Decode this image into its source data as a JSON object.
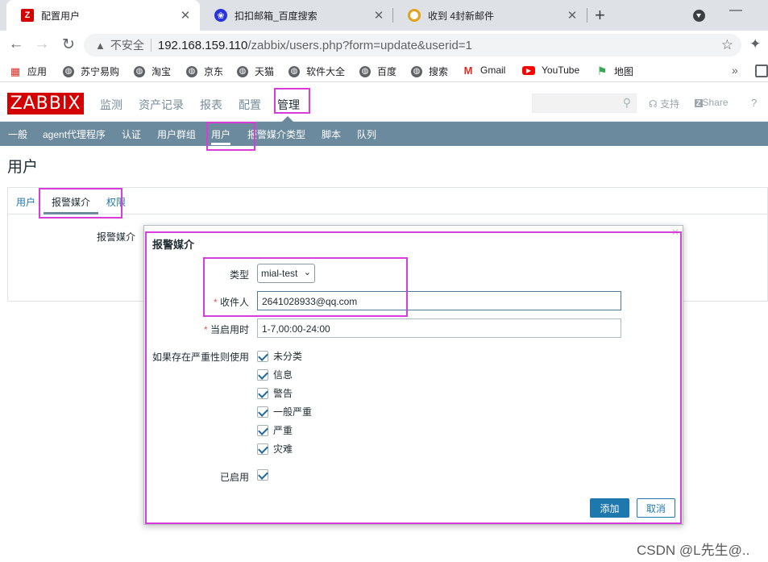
{
  "browser": {
    "tabs": [
      {
        "title": "配置用户",
        "favicon": "zabbix-z"
      },
      {
        "title": "扣扣邮箱_百度搜索",
        "favicon": "baidu-paw"
      },
      {
        "title": "收到 4封新邮件",
        "favicon": "mail-ring"
      }
    ],
    "omnibox": {
      "security_label": "不安全",
      "host": "192.168.159.110",
      "path": "/zabbix/users.php?form=update&userid=1"
    },
    "bookmarks": [
      "应用",
      "苏宁易购",
      "淘宝",
      "京东",
      "天猫",
      "软件大全",
      "百度",
      "搜索",
      "Gmail",
      "YouTube",
      "地图"
    ]
  },
  "zabbix": {
    "logo": "ZABBIX",
    "menu": [
      "监测",
      "资产记录",
      "报表",
      "配置",
      "管理"
    ],
    "support": "支持",
    "share": "Share",
    "help": "?",
    "submenu": [
      "一般",
      "agent代理程序",
      "认证",
      "用户群组",
      "用户",
      "报警媒介类型",
      "脚本",
      "队列"
    ],
    "page_title": "用户",
    "form_tabs": [
      "用户",
      "报警媒介",
      "权限"
    ],
    "media_label": "报警媒介"
  },
  "dialog": {
    "title": "报警媒介",
    "type_label": "类型",
    "type_value": "mial-test",
    "sendto_label": "收件人",
    "sendto_value": "2641028933@qq.com",
    "period_label": "当启用时",
    "period_value": "1-7,00:00-24:00",
    "severity_label": "如果存在严重性则使用",
    "severities": [
      "未分类",
      "信息",
      "警告",
      "一般严重",
      "严重",
      "灾难"
    ],
    "enabled_label": "已启用",
    "add_button": "添加",
    "cancel_button": "取消"
  },
  "watermark": "CSDN @L先生@..",
  "colors": {
    "zabbix_red": "#d40000",
    "subnav": "#6b8a9d",
    "highlight": "#d93dd9",
    "primary": "#1f78ad"
  }
}
